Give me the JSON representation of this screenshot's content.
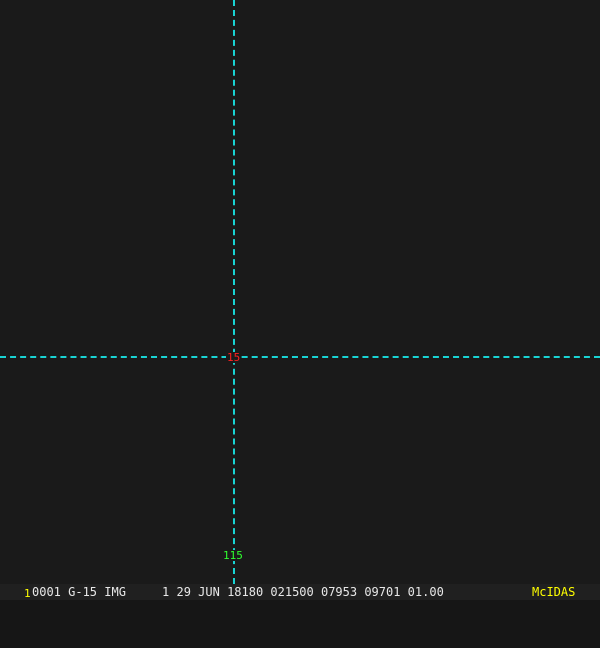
{
  "overlay": {
    "latitude_label": "15",
    "longitude_label": "115"
  },
  "status_bar": {
    "frame_number": "1",
    "info": "0001 G-15 IMG     1 29 JUN 18180 021500 07953 09701 01.00",
    "brand": "McIDAS"
  },
  "colors": {
    "grid": "#19d3d3",
    "lat_label": "#ff2020",
    "lon_label": "#30ff30",
    "brand": "#ffff00"
  }
}
